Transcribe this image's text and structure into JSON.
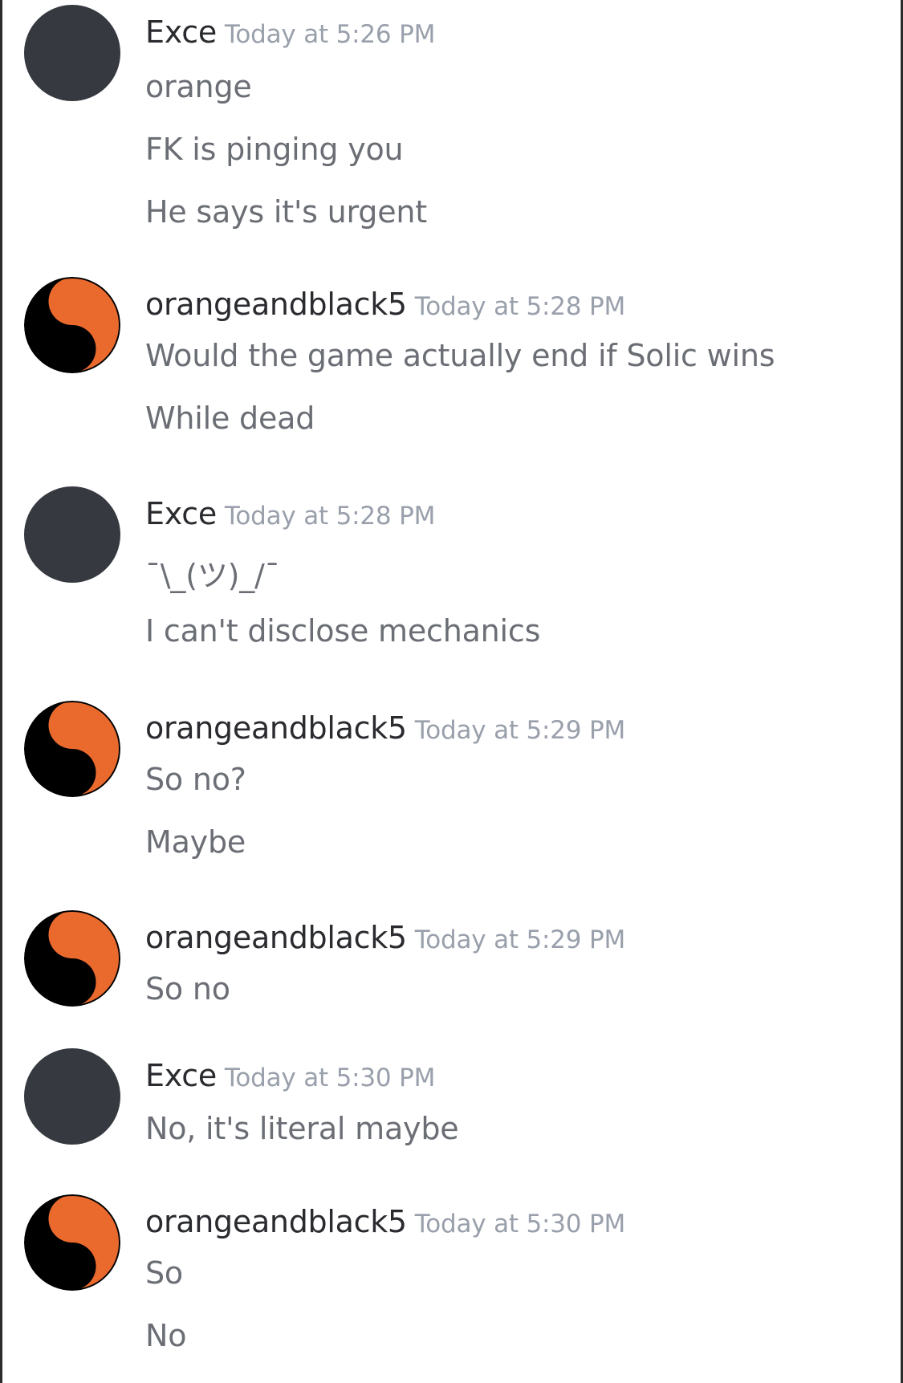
{
  "colors": {
    "avatar_default": "#363940",
    "orange": "#ea6a2e",
    "black": "#000000",
    "username": "#2a2b2f",
    "timestamp": "#99a0ab",
    "message": "#6b6e75"
  },
  "messages": [
    {
      "author": "Exce",
      "time": "Today at 5:26 PM",
      "avatar_icon": "default-avatar",
      "lines": [
        "orange",
        "FK is pinging you",
        "He says it's urgent"
      ]
    },
    {
      "author": "orangeandblack5",
      "time": "Today at 5:28 PM",
      "avatar_icon": "yin-yang-icon",
      "lines": [
        "Would the game actually end if Solic wins",
        "While dead"
      ]
    },
    {
      "author": "Exce",
      "time": "Today at 5:28 PM",
      "avatar_icon": "default-avatar",
      "lines": [
        "¯\\_(ツ)_/¯",
        "I can't disclose mechanics"
      ]
    },
    {
      "author": "orangeandblack5",
      "time": "Today at 5:29 PM",
      "avatar_icon": "yin-yang-icon",
      "lines": [
        "So no?",
        "Maybe"
      ]
    },
    {
      "author": "orangeandblack5",
      "time": "Today at 5:29 PM",
      "avatar_icon": "yin-yang-icon",
      "lines": [
        "So no"
      ]
    },
    {
      "author": "Exce",
      "time": "Today at 5:30 PM",
      "avatar_icon": "default-avatar",
      "lines": [
        "No, it's literal maybe"
      ]
    },
    {
      "author": "orangeandblack5",
      "time": "Today at 5:30 PM",
      "avatar_icon": "yin-yang-icon",
      "lines": [
        "So",
        "No"
      ]
    }
  ]
}
